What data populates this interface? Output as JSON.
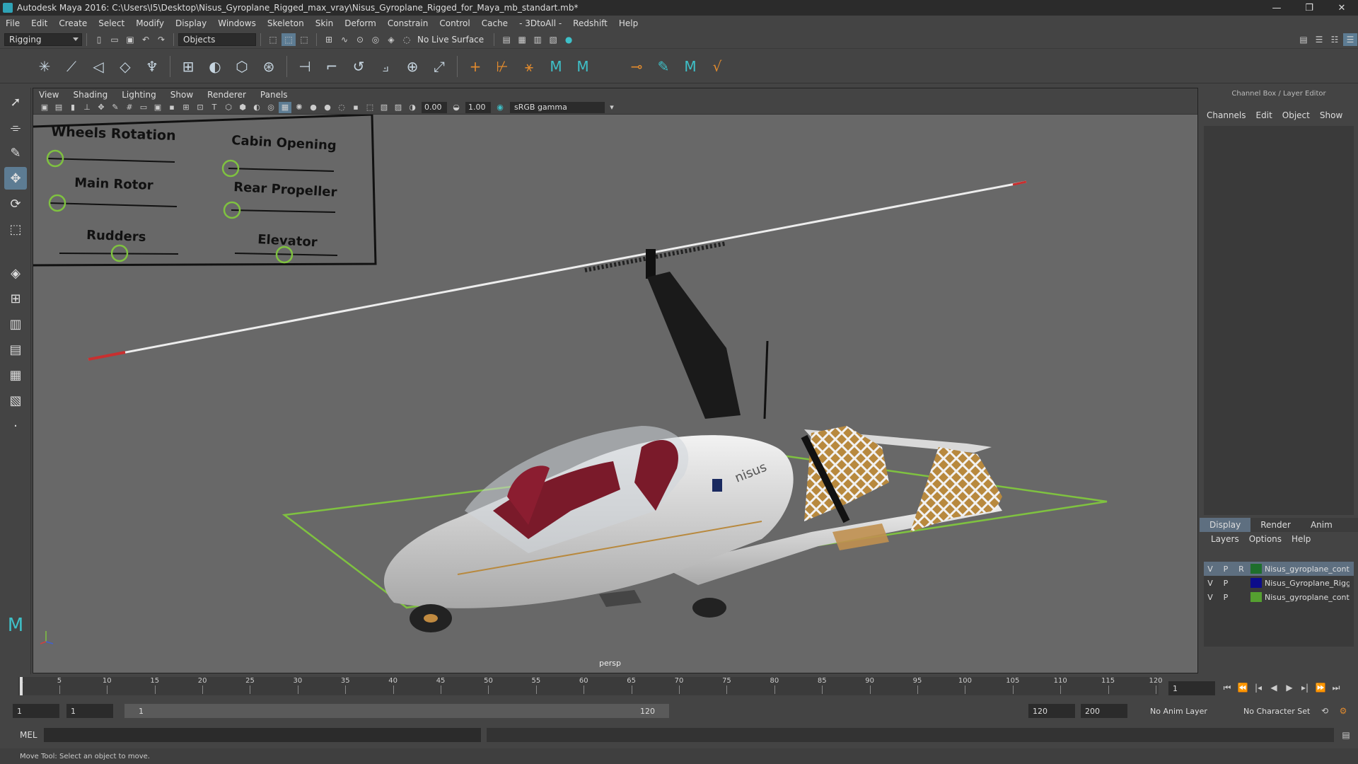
{
  "window": {
    "title": "Autodesk Maya 2016: C:\\Users\\I5\\Desktop\\Nisus_Gyroplane_Rigged_max_vray\\Nisus_Gyroplane_Rigged_for_Maya_mb_standart.mb*",
    "minimize": "—",
    "maximize": "❐",
    "close": "✕"
  },
  "menubar": [
    "File",
    "Edit",
    "Create",
    "Select",
    "Modify",
    "Display",
    "Windows",
    "Skeleton",
    "Skin",
    "Deform",
    "Constrain",
    "Control",
    "Cache",
    "- 3DtoAll -",
    "Redshift",
    "Help"
  ],
  "statusline": {
    "menuset": "Rigging",
    "selection_mode": "Objects",
    "live_surface": "No Live Surface"
  },
  "panel": {
    "menus": [
      "View",
      "Shading",
      "Lighting",
      "Show",
      "Renderer",
      "Panels"
    ],
    "exposure": "0.00",
    "gamma": "1.00",
    "color_space": "sRGB gamma",
    "camera_label": "persp"
  },
  "control_panel": {
    "labels": [
      "Wheels Rotation",
      "Cabin Opening",
      "Main Rotor",
      "Rear Propeller",
      "Rudders",
      "Elevator"
    ]
  },
  "aircraft": {
    "brand_text": "nisus"
  },
  "channel_box": {
    "header": "Channel Box / Layer Editor",
    "tabs": [
      "Channels",
      "Edit",
      "Object",
      "Show"
    ]
  },
  "layer_editor": {
    "tabs": [
      "Display",
      "Render",
      "Anim"
    ],
    "active_tab": "Display",
    "menus": [
      "Layers",
      "Options",
      "Help"
    ],
    "layers": [
      {
        "v": "V",
        "p": "P",
        "r": "R",
        "name": "Nisus_gyroplane_cont",
        "color": "#1e6e2c",
        "selected": true
      },
      {
        "v": "V",
        "p": "P",
        "r": "",
        "name": "Nisus_Gyroplane_Rigg",
        "color": "#0c0c8a",
        "selected": false
      },
      {
        "v": "V",
        "p": "P",
        "r": "",
        "name": "Nisus_gyroplane_cont",
        "color": "#55a030",
        "selected": false
      }
    ]
  },
  "timeline": {
    "ticks": [
      "1",
      "5",
      "10",
      "15",
      "20",
      "25",
      "30",
      "35",
      "40",
      "45",
      "50",
      "55",
      "60",
      "65",
      "70",
      "75",
      "80",
      "85",
      "90",
      "95",
      "100",
      "105",
      "110",
      "115",
      "120"
    ],
    "current_frame": "1"
  },
  "range": {
    "start": "1",
    "playback_start": "1",
    "slider_start": "1",
    "slider_end": "120",
    "playback_end": "120",
    "end": "200",
    "anim_layer": "No Anim Layer",
    "character_set": "No Character Set"
  },
  "command": {
    "label": "MEL"
  },
  "help_line": "Move Tool: Select an object to move."
}
